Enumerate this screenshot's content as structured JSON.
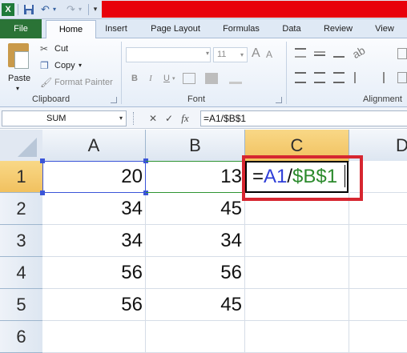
{
  "quick_access": {
    "icons": [
      "excel-icon",
      "save-icon",
      "undo-icon",
      "undo-dropdown-icon",
      "redo-icon",
      "redo-dropdown-icon",
      "customize-icon"
    ]
  },
  "tabs": [
    "File",
    "Home",
    "Insert",
    "Page Layout",
    "Formulas",
    "Data",
    "Review",
    "View"
  ],
  "ribbon": {
    "clipboard": {
      "paste": "Paste",
      "cut": "Cut",
      "copy": "Copy",
      "format_painter": "Format Painter",
      "group_label": "Clipboard"
    },
    "font": {
      "font_name": "",
      "font_size": "11",
      "bold": "B",
      "italic": "I",
      "underline": "U",
      "grow": "A",
      "shrink": "A",
      "group_label": "Font"
    },
    "alignment": {
      "group_label": "Alignment"
    }
  },
  "formula_bar": {
    "name_box": "SUM",
    "cancel": "✕",
    "enter": "✓",
    "fx": "fx",
    "formula": "=A1/$B$1"
  },
  "columns": [
    "A",
    "B",
    "C",
    "D"
  ],
  "rows": [
    "1",
    "2",
    "3",
    "4",
    "5",
    "6"
  ],
  "cells": {
    "A": [
      "20",
      "34",
      "34",
      "56",
      "56",
      ""
    ],
    "B": [
      "13",
      "45",
      "34",
      "56",
      "45",
      ""
    ]
  },
  "active_cell": {
    "parts": {
      "eq": "=",
      "ref1": "A1",
      "op": "/",
      "ref2": "$B$1"
    }
  },
  "colors": {
    "file_tab": "#2a7336",
    "ref_a1": "#2f3ed8",
    "ref_b1": "#2b8a2c",
    "callout": "#d62630",
    "selected_header": "#f1c15f"
  }
}
